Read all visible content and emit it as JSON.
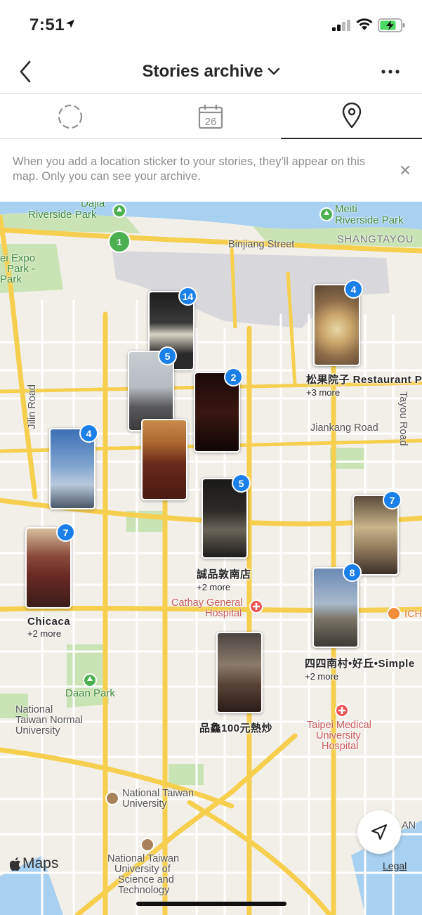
{
  "status_bar": {
    "time": "7:51"
  },
  "header": {
    "title": "Stories archive"
  },
  "tabs": [
    {
      "name": "stories",
      "icon": "circle-dashed-icon"
    },
    {
      "name": "calendar",
      "icon": "calendar-icon",
      "day": "26"
    },
    {
      "name": "map",
      "icon": "location-pin-icon",
      "active": true
    }
  ],
  "notice": {
    "text": "When you add a location sticker to your stories, they'll appear on this map. Only you can see your archive."
  },
  "map_labels": {
    "dajia": "Dajia",
    "riverside_park": "Riverside Park",
    "meiti": "Meiti",
    "meiti_park": "Riverside Park",
    "shangtayou": "SHANGTAYOU",
    "binjiang": "Binjiang Street",
    "expo1": "ei Expo",
    "expo2": "Park -",
    "expo3": "Park",
    "jilin": "Jilin Road",
    "jiankang": "Jiankang Road",
    "tayou": "Tayou Road",
    "cathay1": "Cathay General",
    "cathay2": "Hospital",
    "ich": "ICH",
    "daan": "Daan Park",
    "ntnu1": "National",
    "ntnu2": "Taiwan Normal",
    "ntnu3": "University",
    "tmu1": "Taipei Medical",
    "tmu2": "University",
    "tmu3": "Hospital",
    "ntu1": "National Taiwan",
    "ntu2": "University",
    "ntust1": "National Taiwan",
    "ntust2": "University of",
    "ntust3": "Science and",
    "ntust4": "Technology",
    "an": "AN",
    "route": "1"
  },
  "pins": [
    {
      "count": "14",
      "name": "",
      "more": ""
    },
    {
      "count": "5",
      "name": "",
      "more": ""
    },
    {
      "count": "2",
      "name": "",
      "more": ""
    },
    {
      "count": "4",
      "name": "松果院子 Restaurant Pi",
      "more": "+3 more"
    },
    {
      "count": "4",
      "name": "",
      "more": ""
    },
    {
      "count": "",
      "name": "",
      "more": ""
    },
    {
      "count": "5",
      "name": "誠品敦南店",
      "more": "+2 more"
    },
    {
      "count": "7",
      "name": "Chicaca",
      "more": "+2 more"
    },
    {
      "count": "7",
      "name": "",
      "more": ""
    },
    {
      "count": "8",
      "name": "四四南村•好丘•Simple",
      "more": "+2 more"
    },
    {
      "count": "",
      "name": "品鱻100元熱炒",
      "more": ""
    }
  ],
  "footer": {
    "maps_brand": "Maps",
    "legal": "Legal"
  },
  "colors": {
    "badge": "#1a7fe8",
    "park": "#c9e3b4",
    "road_major": "#f6cf4e",
    "water": "#a8d0f0"
  }
}
